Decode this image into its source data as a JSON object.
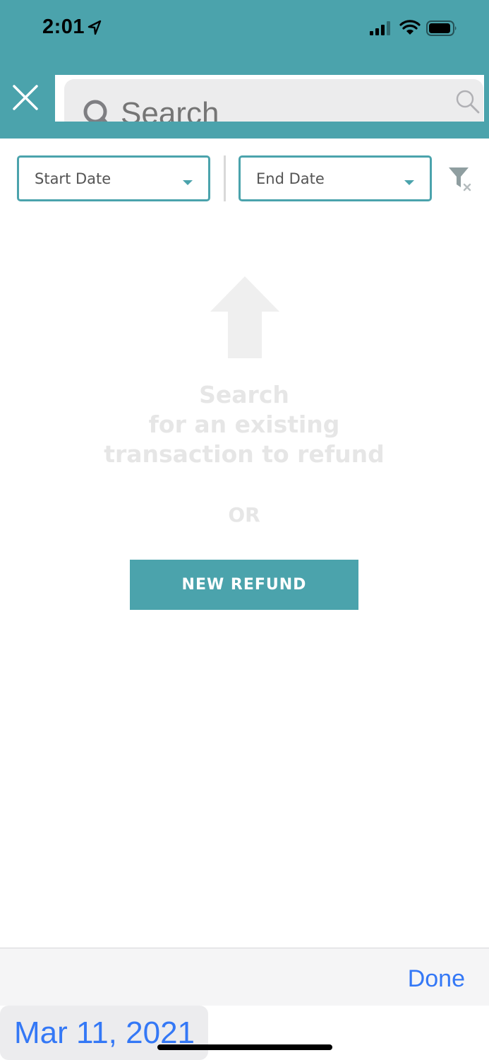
{
  "status_bar": {
    "time": "2:01"
  },
  "header": {
    "search_placeholder": "Search"
  },
  "filters": {
    "start_date_label": "Start Date",
    "end_date_label": "End Date"
  },
  "empty_state": {
    "lines": [
      "Search",
      "for an existing",
      "transaction to refund"
    ],
    "or_label": "OR"
  },
  "actions": {
    "new_refund_label": "NEW REFUND"
  },
  "date_picker": {
    "done_label": "Done",
    "selected_date": "Mar 11, 2021"
  },
  "colors": {
    "teal": "#4ba3ac",
    "ios_blue": "#3478f6",
    "placeholder_gray": "#e6e6e6"
  },
  "icons": [
    "location-arrow-icon",
    "cellular-signal-icon",
    "wifi-icon",
    "battery-icon",
    "close-icon",
    "search-icon",
    "filter-clear-icon",
    "up-arrow-icon",
    "chevron-down-icon"
  ]
}
